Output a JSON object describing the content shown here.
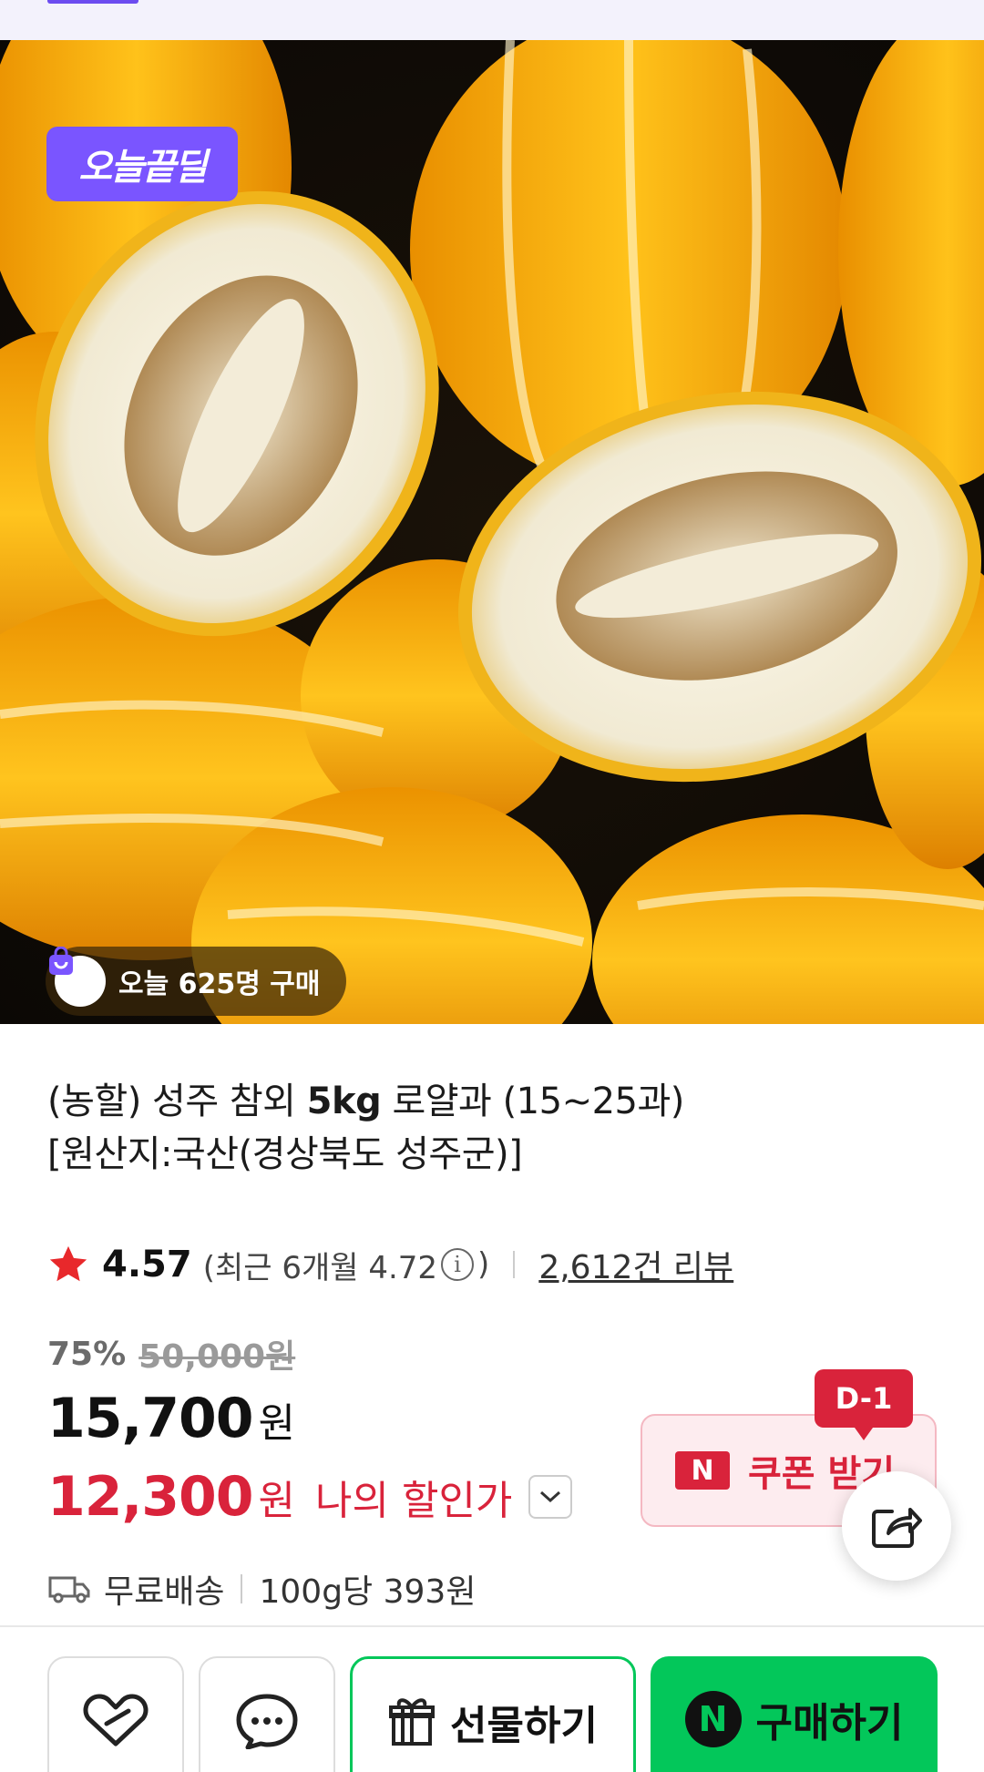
{
  "hero": {
    "deal_badge": "오늘끝딜",
    "buyers_text": "오늘 625명 구매"
  },
  "product": {
    "title_prefix": "(농할) 성주 참외 ",
    "title_bold": "5kg",
    "title_suffix": " 로얄과 (15~25과)",
    "title_line2": "[원산지:국산(경상북도 성주군)]"
  },
  "rating": {
    "score": "4.57",
    "recent_prefix": "(최근 6개월 4.72",
    "recent_suffix": ")",
    "info_glyph": "i",
    "reviews": "2,612건 리뷰",
    "star_color": "#e8282b"
  },
  "price": {
    "discount_pct": "75%",
    "original": "50,000원",
    "sale": "15,700",
    "currency": "원",
    "my_price": "12,300",
    "my_price_label": "나의 할인가"
  },
  "coupon": {
    "badge": "D-1",
    "logo": "N",
    "label": "쿠폰 받기"
  },
  "shipping": {
    "free": "무료배송",
    "unit_price": "100g당 393원"
  },
  "actions": {
    "gift": "선물하기",
    "buy_logo": "N",
    "buy": "구매하기"
  },
  "colors": {
    "accent_red": "#d9233b",
    "naver_green": "#03c75a",
    "deal_purple": "#7a55ff"
  }
}
